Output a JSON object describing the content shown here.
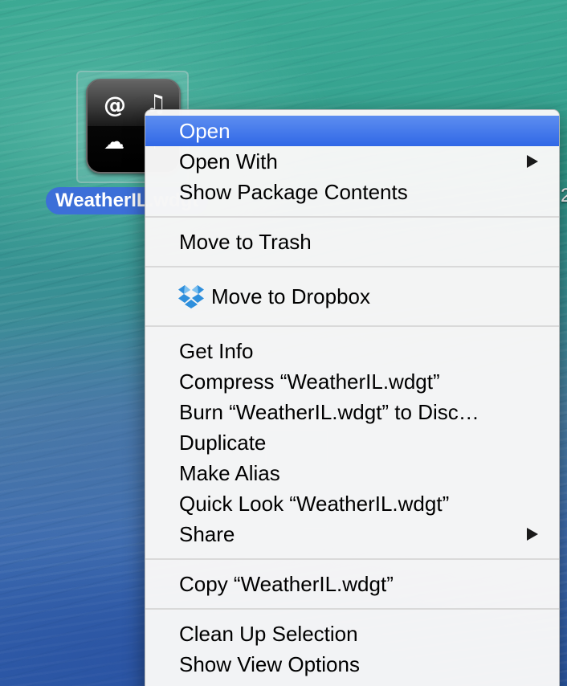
{
  "desktop": {
    "icon": {
      "label": "WeatherIL.wdgt",
      "glyphs": {
        "at": "@",
        "music": "♫",
        "cloud": "☁",
        "sun": "☀"
      },
      "icon_name": "widget-app-icon"
    },
    "edge_text": "2"
  },
  "context_menu": {
    "group1": {
      "open": "Open",
      "open_with": "Open With",
      "show_package_contents": "Show Package Contents"
    },
    "group2": {
      "move_to_trash": "Move to Trash"
    },
    "group3": {
      "move_to_dropbox": "Move to Dropbox",
      "dropbox_icon": "dropbox-icon"
    },
    "group4": {
      "get_info": "Get Info",
      "compress": "Compress “WeatherIL.wdgt”",
      "burn": "Burn “WeatherIL.wdgt” to Disc…",
      "duplicate": "Duplicate",
      "make_alias": "Make Alias",
      "quick_look": "Quick Look “WeatherIL.wdgt”",
      "share": "Share"
    },
    "group5": {
      "copy": "Copy “WeatherIL.wdgt”"
    },
    "group6": {
      "clean_up_selection": "Clean Up Selection",
      "show_view_options": "Show View Options"
    },
    "colors": {
      "highlight": "#3068e6",
      "label_selection": "#3c6fd8"
    }
  }
}
